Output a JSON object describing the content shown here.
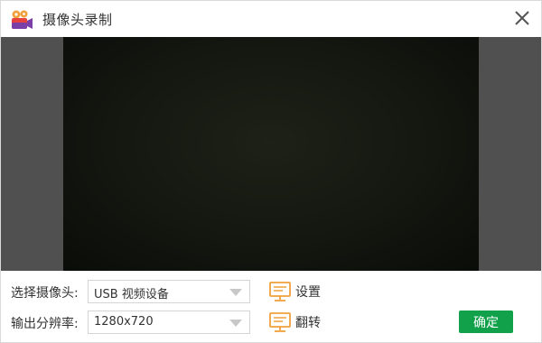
{
  "window": {
    "title": "摄像头录制",
    "app_icon": "video-camera-icon",
    "close_icon": "close-icon"
  },
  "preview": {
    "frame_color": "#141710",
    "background_color": "#505050"
  },
  "controls": {
    "camera": {
      "label": "选择摄像头:",
      "value": "USB 视频设备",
      "action_label": "设置",
      "action_icon": "monitor-icon"
    },
    "resolution": {
      "label": "输出分辨率:",
      "value": "1280x720",
      "action_label": "翻转",
      "action_icon": "monitor-icon"
    }
  },
  "confirm": {
    "label": "确定",
    "color": "#12a14b"
  },
  "colors": {
    "accent_orange": "#f0a03c",
    "brand_red": "#e8423f",
    "brand_purple": "#7b3fa8"
  }
}
